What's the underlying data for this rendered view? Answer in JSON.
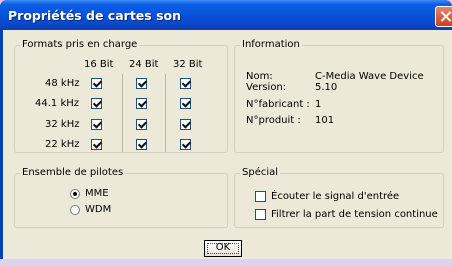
{
  "window": {
    "title": "Propriétés de cartes son"
  },
  "formats": {
    "legend": "Formats pris en charge",
    "columns": [
      "16 Bit",
      "24 Bit",
      "32 Bit"
    ],
    "rows": [
      {
        "rate": "48 kHz",
        "checked": [
          true,
          true,
          true
        ]
      },
      {
        "rate": "44.1 kHz",
        "checked": [
          true,
          true,
          true
        ]
      },
      {
        "rate": "32 kHz",
        "checked": [
          true,
          true,
          true
        ]
      },
      {
        "rate": "22 kHz",
        "checked": [
          true,
          true,
          true
        ]
      }
    ]
  },
  "information": {
    "legend": "Information",
    "items": [
      {
        "label": "Nom:",
        "value": "C-Media Wave Device"
      },
      {
        "label": "Version:",
        "value": "5.10"
      },
      {
        "label": "N°fabricant :",
        "value": "1"
      },
      {
        "label": "N°produit :",
        "value": "101"
      }
    ]
  },
  "drivers": {
    "legend": "Ensemble de pilotes",
    "options": [
      {
        "label": "MME",
        "selected": true
      },
      {
        "label": "WDM",
        "selected": false
      }
    ]
  },
  "special": {
    "legend": "Spécial",
    "options": [
      {
        "label": "Écouter le signal d'entrée",
        "checked": false
      },
      {
        "label": "Filtrer la part de tension continue",
        "checked": false
      }
    ]
  },
  "buttons": {
    "ok": "OK"
  },
  "colors": {
    "titlebar": "#0850d8",
    "dialog": "#ece9d8",
    "close": "#d9532b"
  }
}
